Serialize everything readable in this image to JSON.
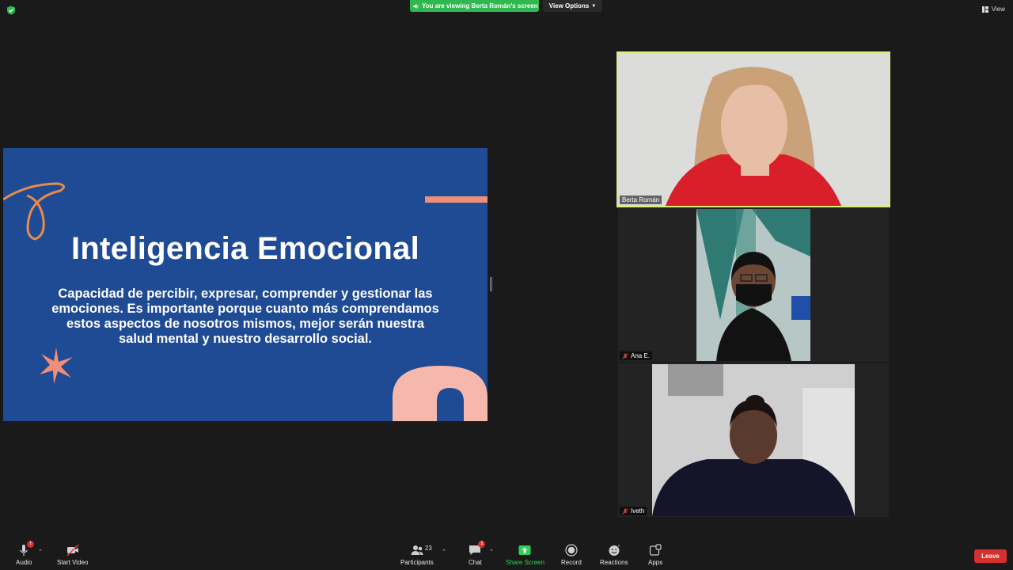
{
  "top_bar": {
    "viewing_banner": "You are viewing Berta Román's screen",
    "view_options": "View Options",
    "view": "View"
  },
  "slide": {
    "title": "Inteligencia Emocional",
    "body": "Capacidad de percibir, expresar, comprender y gestionar las emociones. Es importante porque cuanto más comprendamos estos aspectos de nosotros mismos, mejor serán nuestra salud mental y nuestro desarrollo social."
  },
  "participants_tiles": [
    {
      "name": "Berta Román",
      "muted": false,
      "active": true
    },
    {
      "name": "Ana E.",
      "muted": true,
      "active": false
    },
    {
      "name": "Iveth",
      "muted": true,
      "active": false
    }
  ],
  "toolbar": {
    "audio": {
      "label": "Audio",
      "badge": "!"
    },
    "video": {
      "label": "Start Video"
    },
    "participants": {
      "label": "Participants",
      "count": "23"
    },
    "chat": {
      "label": "Chat",
      "badge": "1"
    },
    "share": {
      "label": "Share Screen"
    },
    "record": {
      "label": "Record"
    },
    "reactions": {
      "label": "Reactions"
    },
    "apps": {
      "label": "Apps"
    },
    "leave": {
      "label": "Leave"
    }
  },
  "colors": {
    "background": "#1a1a1a",
    "slide_blue": "#1f4a94",
    "accent_green": "#2fb84f",
    "active_speaker_border": "#d6f079",
    "leave_red": "#d62f2f",
    "deco_orange": "#e88b4d",
    "deco_pink": "#f4b7ad"
  }
}
